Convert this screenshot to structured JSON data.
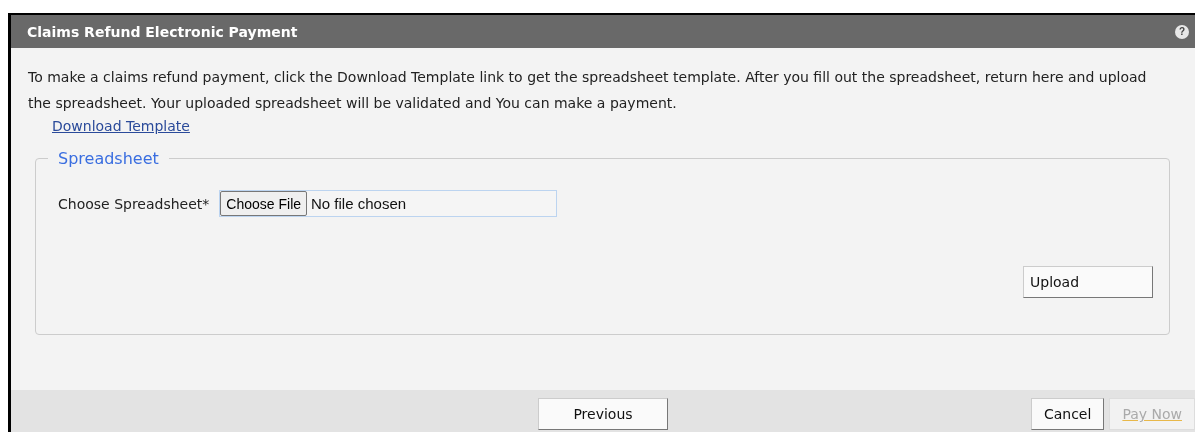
{
  "window": {
    "title": "Claims Refund Electronic Payment",
    "help": "?"
  },
  "instructions": "To make a claims refund payment, click the Download Template link to get the spreadsheet template. After you fill out the spreadsheet, return here and upload the spreadsheet. Your uploaded spreadsheet will be validated and You can make a payment.",
  "download_link": "Download Template",
  "spreadsheet": {
    "legend": "Spreadsheet",
    "label": "Choose Spreadsheet*",
    "file_button": "Choose File",
    "file_status": "No file chosen",
    "upload_button": "Upload"
  },
  "footer": {
    "buttons": [
      {
        "label": "Previous",
        "kind": "center",
        "disabled": false
      },
      {
        "label": "Cancel",
        "kind": "right",
        "disabled": false
      },
      {
        "label": "Pay Now",
        "kind": "right",
        "disabled": true
      }
    ]
  }
}
